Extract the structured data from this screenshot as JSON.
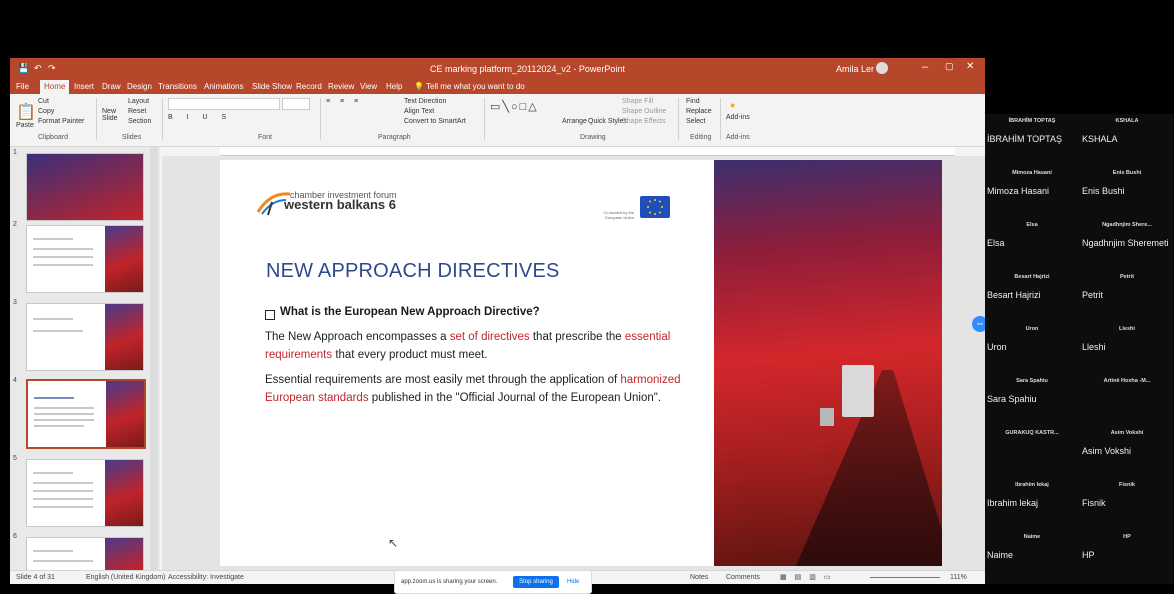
{
  "window": {
    "title": "CE marking platform_20112024_v2 - PowerPoint",
    "user": "Amila Ler"
  },
  "ribbon_tabs": [
    "File",
    "Home",
    "Insert",
    "Draw",
    "Design",
    "Transitions",
    "Animations",
    "Slide Show",
    "Record",
    "Review",
    "View",
    "Help"
  ],
  "tell_me": "Tell me what you want to do",
  "ribbon": {
    "clipboard": {
      "cut": "Cut",
      "copy": "Copy",
      "paste": "Paste",
      "format_painter": "Format Painter",
      "group": "Clipboard"
    },
    "slides": {
      "new_slide": "New Slide",
      "layout": "Layout",
      "reset": "Reset",
      "section": "Section",
      "group": "Slides"
    },
    "font": {
      "group": "Font"
    },
    "paragraph": {
      "text_direction": "Text Direction",
      "align_text": "Align Text",
      "convert": "Convert to SmartArt",
      "group": "Paragraph"
    },
    "drawing": {
      "arrange": "Arrange",
      "quick_styles": "Quick Styles",
      "shape_fill": "Shape Fill",
      "shape_outline": "Shape Outline",
      "shape_effects": "Shape Effects",
      "group": "Drawing"
    },
    "editing": {
      "find": "Find",
      "replace": "Replace",
      "select": "Select",
      "group": "Editing"
    },
    "addins": {
      "addins": "Add-ins",
      "group": "Add-ins"
    }
  },
  "thumbnails": [
    {
      "num": "1"
    },
    {
      "num": "2"
    },
    {
      "num": "3"
    },
    {
      "num": "4"
    },
    {
      "num": "5"
    },
    {
      "num": "6"
    }
  ],
  "slide": {
    "logo_top": "chamber investment forum",
    "logo_main": "western balkans 6",
    "eu_text": "Co-funded by the European Union",
    "headline": "NEW APPROACH DIRECTIVES",
    "question": "What is the European New Approach Directive?",
    "p1_a": "The New Approach encompasses a ",
    "p1_red1": "set of directives",
    "p1_b": " that prescribe the ",
    "p1_red2": "essential requirements",
    "p1_c": " that every product must meet.",
    "p2_a": "Essential requirements are most easily met through the application of ",
    "p2_red": "harmonized European standards",
    "p2_b": " published in the \"Official Journal of the European Union\"."
  },
  "status": {
    "slide_of": "Slide 4 of 31",
    "language": "English (United Kingdom)",
    "accessibility": "Accessibility: Investigate",
    "notes": "Notes",
    "comments": "Comments",
    "zoom": "111%"
  },
  "share_banner": {
    "text": "app.zoom.us is sharing your screen.",
    "stop": "Stop sharing",
    "hide": "Hide"
  },
  "participants": [
    {
      "top": "İBRAHİM TOPTAŞ",
      "name": "İBRAHİM TOPTAŞ"
    },
    {
      "top": "KSHALA",
      "name": "KSHALA"
    },
    {
      "top": "Mimoza Hasani",
      "name": "Mimoza Hasani"
    },
    {
      "top": "Enis Bushi",
      "name": "Enis Bushi"
    },
    {
      "top": "Elsa",
      "name": "Elsa"
    },
    {
      "top": "Ngadhnjim Shere...",
      "name": "Ngadhnjim Sheremeti"
    },
    {
      "top": "Besart Hajrizi",
      "name": "Besart Hajrizi"
    },
    {
      "top": "Petrit",
      "name": "Petrit"
    },
    {
      "top": "Uron",
      "name": "Uron"
    },
    {
      "top": "Lleshi",
      "name": "Lleshi"
    },
    {
      "top": "Sara Spahiu",
      "name": "Sara Spahiu"
    },
    {
      "top": "Artinë Hoxha -M...",
      "name": ""
    },
    {
      "top": "GURAKUQ KASTR...",
      "name": ""
    },
    {
      "top": "Asim Vokshi",
      "name": "Asim Vokshi"
    },
    {
      "top": "Ibrahim lekaj",
      "name": "Ibrahim lekaj"
    },
    {
      "top": "Fisnik",
      "name": "Fisnik"
    },
    {
      "top": "Naime",
      "name": "Naime"
    },
    {
      "top": "HP",
      "name": "HP"
    }
  ],
  "colors": {
    "ppt_accent": "#b7472a",
    "headline": "#2e4a8c",
    "highlight": "#c0272d",
    "zoom_blue": "#0e71eb"
  }
}
